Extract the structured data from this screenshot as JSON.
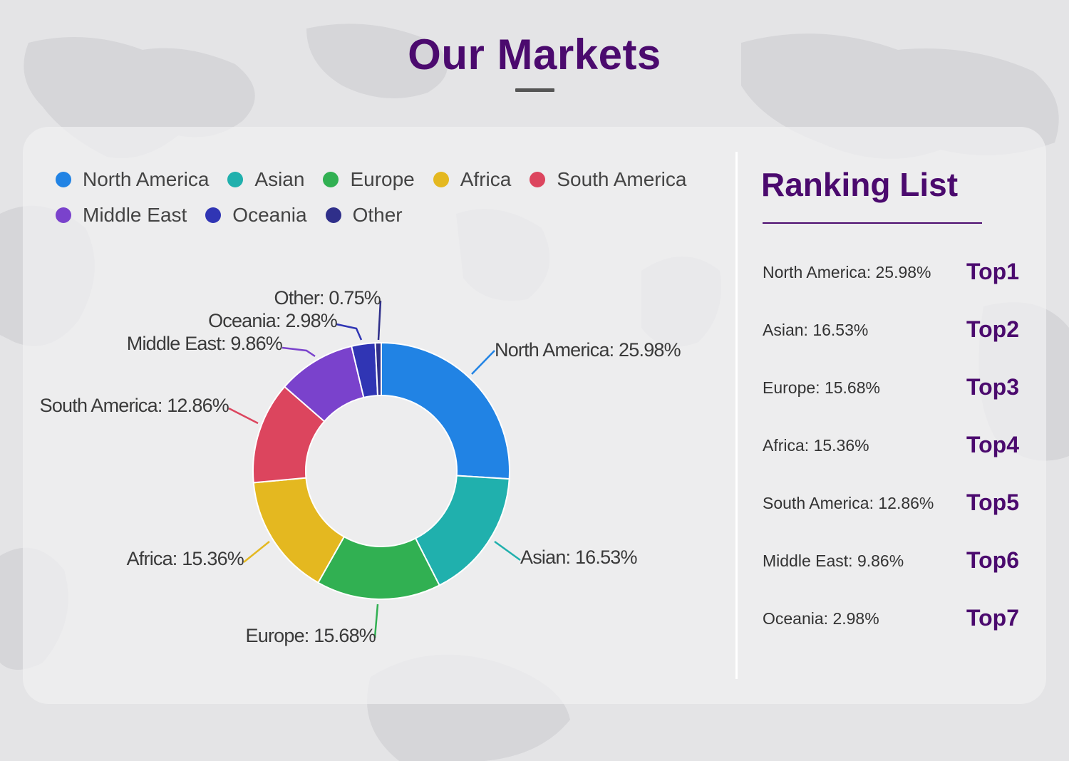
{
  "page": {
    "title": "Our Markets"
  },
  "colors": {
    "title": "#4b0a6e",
    "north_america": "#2183e4",
    "asian": "#20b0ad",
    "europe": "#31b052",
    "africa": "#e4b820",
    "south_america": "#dc455e",
    "middle_east": "#7a42cc",
    "oceania": "#3035b4",
    "other": "#2f2f8a"
  },
  "legend": {
    "rows": [
      [
        {
          "label": "North America",
          "color": "#2183e4"
        },
        {
          "label": "Asian",
          "color": "#20b0ad"
        },
        {
          "label": "Europe",
          "color": "#31b052"
        },
        {
          "label": "Africa",
          "color": "#e4b820"
        },
        {
          "label": "South America",
          "color": "#dc455e"
        }
      ],
      [
        {
          "label": "Middle East",
          "color": "#7a42cc"
        },
        {
          "label": "Oceania",
          "color": "#3035b4"
        },
        {
          "label": "Other",
          "color": "#2f2f8a"
        }
      ]
    ]
  },
  "chart_data": {
    "type": "pie",
    "donut": true,
    "legend_position": "top-left",
    "unit": "%",
    "categories": [
      "North America",
      "Asian",
      "Europe",
      "Africa",
      "South America",
      "Middle East",
      "Oceania",
      "Other"
    ],
    "values": [
      25.98,
      16.53,
      15.68,
      15.36,
      12.86,
      9.86,
      2.98,
      0.75
    ],
    "data_labels": [
      "North America: 25.98%",
      "Asian: 16.53%",
      "Europe: 15.68%",
      "Africa: 15.36%",
      "South America: 12.86%",
      "Middle East: 9.86%",
      "Oceania: 2.98%",
      "Other: 0.75%"
    ],
    "colors": [
      "#2183e4",
      "#20b0ad",
      "#31b052",
      "#e4b820",
      "#dc455e",
      "#7a42cc",
      "#3035b4",
      "#2f2f8a"
    ]
  },
  "ranking": {
    "title": "Ranking List",
    "items": [
      {
        "text": "North America: 25.98%",
        "rank": "Top1"
      },
      {
        "text": "Asian: 16.53%",
        "rank": "Top2"
      },
      {
        "text": "Europe: 15.68%",
        "rank": "Top3"
      },
      {
        "text": "Africa: 15.36%",
        "rank": "Top4"
      },
      {
        "text": "South America: 12.86%",
        "rank": "Top5"
      },
      {
        "text": "Middle East: 9.86%",
        "rank": "Top6"
      },
      {
        "text": "Oceania: 2.98%",
        "rank": "Top7"
      }
    ]
  }
}
